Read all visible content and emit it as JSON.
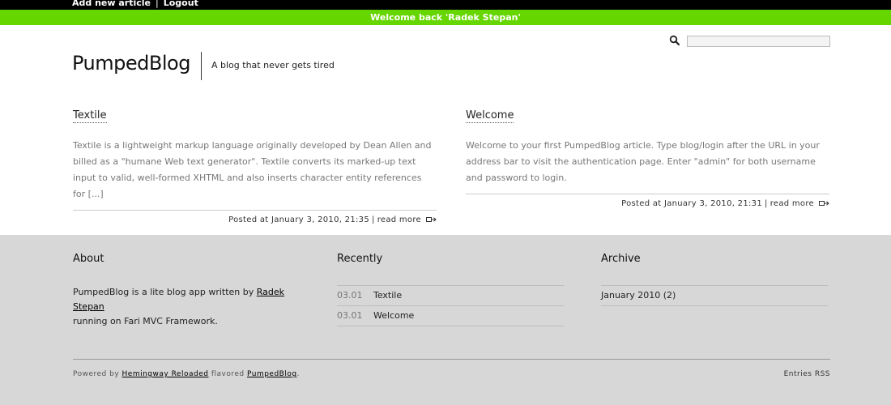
{
  "admin_links": {
    "add_article": "Add new article",
    "separator": "|",
    "logout": "Logout"
  },
  "welcome_message": "Welcome back 'Radek Stepan'",
  "search": {
    "placeholder": ""
  },
  "site": {
    "title": "PumpedBlog",
    "tagline": "A blog that never gets tired"
  },
  "posts": [
    {
      "title": "Textile",
      "excerpt": "Textile is a lightweight markup language originally developed by Dean Allen and billed as a \"humane Web text generator\". Textile converts its marked-up text input to valid, well-formed XHTML and also inserts character entity references for [...]",
      "posted": "Posted at January 3, 2010, 21:35",
      "read_more": "read more"
    },
    {
      "title": "Welcome",
      "excerpt": "Welcome to your first PumpedBlog article. Type blog/login after the URL in your address bar to visit the authentication page. Enter \"admin\" for both username and password to login.",
      "posted": "Posted at January 3, 2010, 21:31",
      "read_more": "read more"
    }
  ],
  "footer": {
    "about": {
      "heading": "About",
      "text_before": "PumpedBlog is a lite blog app written by ",
      "author_link": "Radek Stepan",
      "text_after": "running on Fari MVC Framework."
    },
    "recently": {
      "heading": "Recently",
      "items": [
        {
          "date": "03.01",
          "title": "Textile"
        },
        {
          "date": "03.01",
          "title": "Welcome"
        }
      ]
    },
    "archive": {
      "heading": "Archive",
      "items": [
        {
          "label": "January 2010 (2)"
        }
      ]
    },
    "credits": {
      "powered_by": "Powered by ",
      "theme_link": "Hemingway Reloaded",
      "flavored": " flavored ",
      "app_link": "PumpedBlog",
      "end": "."
    },
    "rss": "Entries RSS"
  },
  "colors": {
    "accent_green": "#66d600",
    "topbar": "#000000",
    "footer_bg": "#d7d7d7"
  }
}
